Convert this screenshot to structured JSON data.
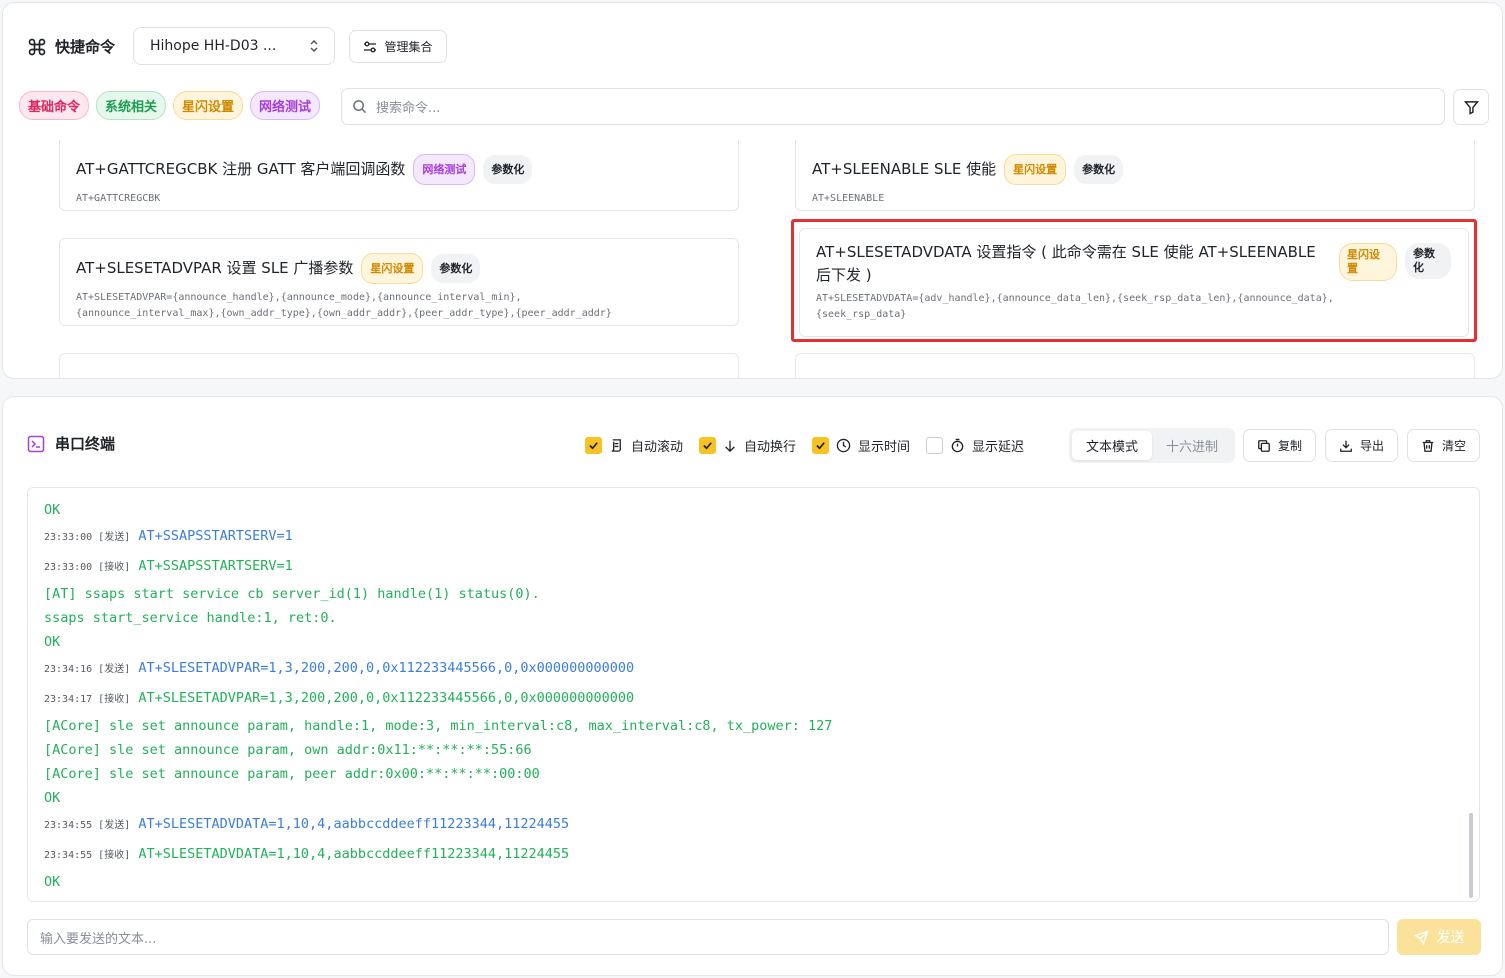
{
  "quick": {
    "title": "快捷命令",
    "device_select": "Hihope HH-D03 ...",
    "manage_label": "管理集合",
    "tags": [
      "基础命令",
      "系统相关",
      "星闪设置",
      "网络测试"
    ],
    "search_placeholder": "搜索命令...",
    "cards": [
      {
        "title": "AT+GATTCREGCBK 注册 GATT 客户端回调函数",
        "badge": "网络测试",
        "param": "参数化",
        "cmd": "AT+GATTCREGCBK"
      },
      {
        "title": "AT+SLEENABLE SLE 使能",
        "badge": "星闪设置",
        "param": "参数化",
        "cmd": "AT+SLEENABLE"
      },
      {
        "title": "AT+SLESETADVPAR 设置 SLE 广播参数",
        "badge": "星闪设置",
        "param": "参数化",
        "cmd": "AT+SLESETADVPAR={announce_handle},{announce_mode},{announce_interval_min},\n{announce_interval_max},{own_addr_type},{own_addr_addr},{peer_addr_type},{peer_addr_addr}"
      },
      {
        "title": "AT+SLESETADVDATA 设置指令 ( 此命令需在 SLE 使能 AT+SLEENABLE 后下发 )",
        "badge": "星闪设置",
        "param": "参数化",
        "cmd": "AT+SLESETADVDATA={adv_handle},{announce_data_len},{seek_rsp_data_len},{announce_data},\n{seek_rsp_data}"
      }
    ]
  },
  "serial": {
    "title": "串口终端",
    "options": [
      {
        "label": "自动滚动",
        "checked": true
      },
      {
        "label": "自动换行",
        "checked": true
      },
      {
        "label": "显示时间",
        "checked": true
      },
      {
        "label": "显示延迟",
        "checked": false
      }
    ],
    "modes": [
      "文本模式",
      "十六进制"
    ],
    "copy": "复制",
    "export": "导出",
    "clear": "清空",
    "lines": [
      {
        "text": "OK"
      },
      {
        "ts": "23:33:00 [发送]",
        "text": "AT+SSAPSSTARTSERV=1",
        "dir": "send"
      },
      {
        "ts": "23:33:00 [接收]",
        "text": "AT+SSAPSSTARTSERV=1",
        "dir": "recv"
      },
      {
        "text": "[AT] ssaps start service cb server_id(1) handle(1) status(0)."
      },
      {
        "text": "ssaps start_service handle:1, ret:0."
      },
      {
        "text": "OK"
      },
      {
        "ts": "23:34:16 [发送]",
        "text": "AT+SLESETADVPAR=1,3,200,200,0,0x112233445566,0,0x000000000000",
        "dir": "send"
      },
      {
        "ts": "23:34:17 [接收]",
        "text": "AT+SLESETADVPAR=1,3,200,200,0,0x112233445566,0,0x000000000000",
        "dir": "recv"
      },
      {
        "text": "[ACore] sle set announce param, handle:1, mode:3, min_interval:c8, max_interval:c8, tx_power: 127"
      },
      {
        "text": "[ACore] sle set announce param, own addr:0x11:**:**:**:55:66"
      },
      {
        "text": "[ACore] sle set announce param, peer addr:0x00:**:**:**:00:00"
      },
      {
        "text": "OK"
      },
      {
        "ts": "23:34:55 [发送]",
        "text": "AT+SLESETADVDATA=1,10,4,aabbccddeeff11223344,11224455",
        "dir": "send"
      },
      {
        "ts": "23:34:55 [接收]",
        "text": "AT+SLESETADVDATA=1,10,4,aabbccddeeff11223344,11224455",
        "dir": "recv"
      },
      {
        "text": "OK"
      }
    ],
    "input_placeholder": "输入要发送的文本...",
    "send_label": "发送"
  }
}
